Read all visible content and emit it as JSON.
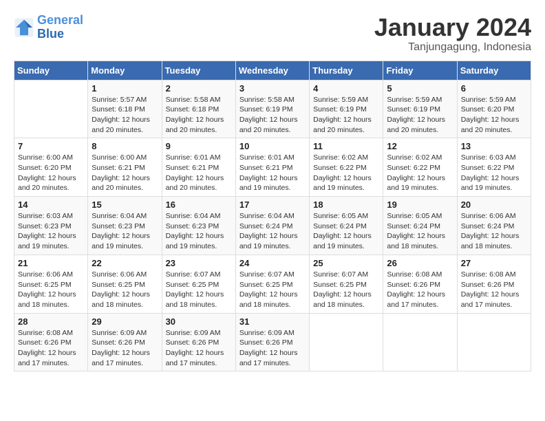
{
  "header": {
    "logo_line1": "General",
    "logo_line2": "Blue",
    "month": "January 2024",
    "location": "Tanjungagung, Indonesia"
  },
  "days_of_week": [
    "Sunday",
    "Monday",
    "Tuesday",
    "Wednesday",
    "Thursday",
    "Friday",
    "Saturday"
  ],
  "weeks": [
    [
      {
        "day": "",
        "sunrise": "",
        "sunset": "",
        "daylight": ""
      },
      {
        "day": "1",
        "sunrise": "Sunrise: 5:57 AM",
        "sunset": "Sunset: 6:18 PM",
        "daylight": "Daylight: 12 hours and 20 minutes."
      },
      {
        "day": "2",
        "sunrise": "Sunrise: 5:58 AM",
        "sunset": "Sunset: 6:18 PM",
        "daylight": "Daylight: 12 hours and 20 minutes."
      },
      {
        "day": "3",
        "sunrise": "Sunrise: 5:58 AM",
        "sunset": "Sunset: 6:19 PM",
        "daylight": "Daylight: 12 hours and 20 minutes."
      },
      {
        "day": "4",
        "sunrise": "Sunrise: 5:59 AM",
        "sunset": "Sunset: 6:19 PM",
        "daylight": "Daylight: 12 hours and 20 minutes."
      },
      {
        "day": "5",
        "sunrise": "Sunrise: 5:59 AM",
        "sunset": "Sunset: 6:19 PM",
        "daylight": "Daylight: 12 hours and 20 minutes."
      },
      {
        "day": "6",
        "sunrise": "Sunrise: 5:59 AM",
        "sunset": "Sunset: 6:20 PM",
        "daylight": "Daylight: 12 hours and 20 minutes."
      }
    ],
    [
      {
        "day": "7",
        "sunrise": "Sunrise: 6:00 AM",
        "sunset": "Sunset: 6:20 PM",
        "daylight": "Daylight: 12 hours and 20 minutes."
      },
      {
        "day": "8",
        "sunrise": "Sunrise: 6:00 AM",
        "sunset": "Sunset: 6:21 PM",
        "daylight": "Daylight: 12 hours and 20 minutes."
      },
      {
        "day": "9",
        "sunrise": "Sunrise: 6:01 AM",
        "sunset": "Sunset: 6:21 PM",
        "daylight": "Daylight: 12 hours and 20 minutes."
      },
      {
        "day": "10",
        "sunrise": "Sunrise: 6:01 AM",
        "sunset": "Sunset: 6:21 PM",
        "daylight": "Daylight: 12 hours and 19 minutes."
      },
      {
        "day": "11",
        "sunrise": "Sunrise: 6:02 AM",
        "sunset": "Sunset: 6:22 PM",
        "daylight": "Daylight: 12 hours and 19 minutes."
      },
      {
        "day": "12",
        "sunrise": "Sunrise: 6:02 AM",
        "sunset": "Sunset: 6:22 PM",
        "daylight": "Daylight: 12 hours and 19 minutes."
      },
      {
        "day": "13",
        "sunrise": "Sunrise: 6:03 AM",
        "sunset": "Sunset: 6:22 PM",
        "daylight": "Daylight: 12 hours and 19 minutes."
      }
    ],
    [
      {
        "day": "14",
        "sunrise": "Sunrise: 6:03 AM",
        "sunset": "Sunset: 6:23 PM",
        "daylight": "Daylight: 12 hours and 19 minutes."
      },
      {
        "day": "15",
        "sunrise": "Sunrise: 6:04 AM",
        "sunset": "Sunset: 6:23 PM",
        "daylight": "Daylight: 12 hours and 19 minutes."
      },
      {
        "day": "16",
        "sunrise": "Sunrise: 6:04 AM",
        "sunset": "Sunset: 6:23 PM",
        "daylight": "Daylight: 12 hours and 19 minutes."
      },
      {
        "day": "17",
        "sunrise": "Sunrise: 6:04 AM",
        "sunset": "Sunset: 6:24 PM",
        "daylight": "Daylight: 12 hours and 19 minutes."
      },
      {
        "day": "18",
        "sunrise": "Sunrise: 6:05 AM",
        "sunset": "Sunset: 6:24 PM",
        "daylight": "Daylight: 12 hours and 19 minutes."
      },
      {
        "day": "19",
        "sunrise": "Sunrise: 6:05 AM",
        "sunset": "Sunset: 6:24 PM",
        "daylight": "Daylight: 12 hours and 18 minutes."
      },
      {
        "day": "20",
        "sunrise": "Sunrise: 6:06 AM",
        "sunset": "Sunset: 6:24 PM",
        "daylight": "Daylight: 12 hours and 18 minutes."
      }
    ],
    [
      {
        "day": "21",
        "sunrise": "Sunrise: 6:06 AM",
        "sunset": "Sunset: 6:25 PM",
        "daylight": "Daylight: 12 hours and 18 minutes."
      },
      {
        "day": "22",
        "sunrise": "Sunrise: 6:06 AM",
        "sunset": "Sunset: 6:25 PM",
        "daylight": "Daylight: 12 hours and 18 minutes."
      },
      {
        "day": "23",
        "sunrise": "Sunrise: 6:07 AM",
        "sunset": "Sunset: 6:25 PM",
        "daylight": "Daylight: 12 hours and 18 minutes."
      },
      {
        "day": "24",
        "sunrise": "Sunrise: 6:07 AM",
        "sunset": "Sunset: 6:25 PM",
        "daylight": "Daylight: 12 hours and 18 minutes."
      },
      {
        "day": "25",
        "sunrise": "Sunrise: 6:07 AM",
        "sunset": "Sunset: 6:25 PM",
        "daylight": "Daylight: 12 hours and 18 minutes."
      },
      {
        "day": "26",
        "sunrise": "Sunrise: 6:08 AM",
        "sunset": "Sunset: 6:26 PM",
        "daylight": "Daylight: 12 hours and 17 minutes."
      },
      {
        "day": "27",
        "sunrise": "Sunrise: 6:08 AM",
        "sunset": "Sunset: 6:26 PM",
        "daylight": "Daylight: 12 hours and 17 minutes."
      }
    ],
    [
      {
        "day": "28",
        "sunrise": "Sunrise: 6:08 AM",
        "sunset": "Sunset: 6:26 PM",
        "daylight": "Daylight: 12 hours and 17 minutes."
      },
      {
        "day": "29",
        "sunrise": "Sunrise: 6:09 AM",
        "sunset": "Sunset: 6:26 PM",
        "daylight": "Daylight: 12 hours and 17 minutes."
      },
      {
        "day": "30",
        "sunrise": "Sunrise: 6:09 AM",
        "sunset": "Sunset: 6:26 PM",
        "daylight": "Daylight: 12 hours and 17 minutes."
      },
      {
        "day": "31",
        "sunrise": "Sunrise: 6:09 AM",
        "sunset": "Sunset: 6:26 PM",
        "daylight": "Daylight: 12 hours and 17 minutes."
      },
      {
        "day": "",
        "sunrise": "",
        "sunset": "",
        "daylight": ""
      },
      {
        "day": "",
        "sunrise": "",
        "sunset": "",
        "daylight": ""
      },
      {
        "day": "",
        "sunrise": "",
        "sunset": "",
        "daylight": ""
      }
    ]
  ]
}
